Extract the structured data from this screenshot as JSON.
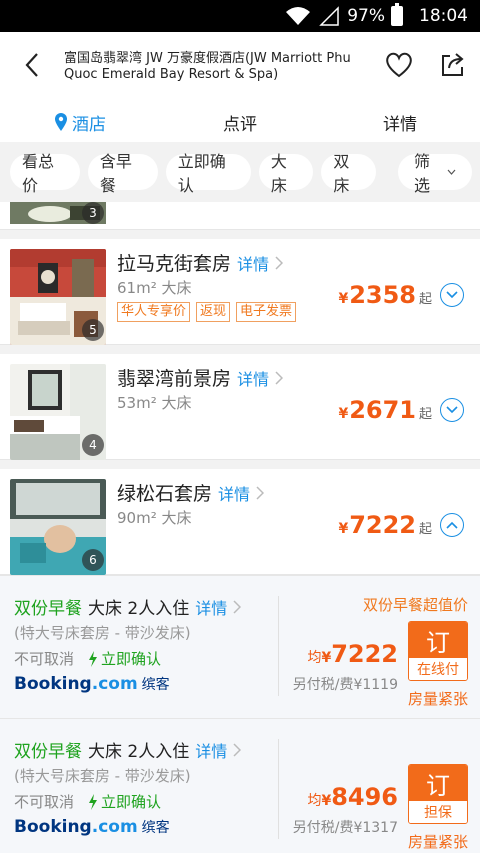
{
  "status_bar": {
    "battery": "97%",
    "time": "18:04"
  },
  "header": {
    "title": "富国岛翡翠湾 JW 万豪度假酒店(JW Marriott Phu Quoc Emerald Bay Resort & Spa)"
  },
  "tabs": [
    {
      "label": "酒店"
    },
    {
      "label": "点评"
    },
    {
      "label": "详情"
    }
  ],
  "filters": {
    "chips": [
      "看总价",
      "含早餐",
      "立即确认",
      "大床",
      "双床"
    ],
    "filter_label": "筛选"
  },
  "partial_room": {
    "photo_count": "3"
  },
  "rooms": [
    {
      "name": "拉马克街套房",
      "detail": "详情",
      "meta": "61m² 大床",
      "tags": [
        "华人专享价",
        "返现",
        "电子发票"
      ],
      "currency": "¥",
      "price": "2358",
      "suffix": "起",
      "photo_count": "5",
      "expanded": false
    },
    {
      "name": "翡翠湾前景房",
      "detail": "详情",
      "meta": "53m² 大床",
      "tags": [],
      "currency": "¥",
      "price": "2671",
      "suffix": "起",
      "photo_count": "4",
      "expanded": false
    },
    {
      "name": "绿松石套房",
      "detail": "详情",
      "meta": "90m² 大床",
      "tags": [],
      "currency": "¥",
      "price": "7222",
      "suffix": "起",
      "photo_count": "6",
      "expanded": true
    }
  ],
  "rate_plans": [
    {
      "meal": "双份早餐",
      "bed": "大床 2人入住",
      "detail": "详情",
      "room_type": "(特大号床套房 - 带沙发床)",
      "cancel": "不可取消",
      "confirm": "立即确认",
      "provider": "Booking",
      "provider_suffix": ".com",
      "provider_cn": "缤客",
      "promo": "双份早餐超值价",
      "price_prefix": "均",
      "currency": "¥",
      "price": "7222",
      "tax": "另付税/费¥1119",
      "book_top": "订",
      "book_bottom": "在线付",
      "scarcity": "房量紧张"
    },
    {
      "meal": "双份早餐",
      "bed": "大床 2人入住",
      "detail": "详情",
      "room_type": "(特大号床套房 - 带沙发床)",
      "cancel": "不可取消",
      "confirm": "立即确认",
      "provider": "Booking",
      "provider_suffix": ".com",
      "provider_cn": "缤客",
      "promo": "",
      "price_prefix": "均",
      "currency": "¥",
      "price": "8496",
      "tax": "另付税/费¥1317",
      "book_top": "订",
      "book_bottom": "担保",
      "scarcity": "房量紧张"
    }
  ],
  "colors": {
    "accent_blue": "#1a8fe3",
    "price_orange": "#f05a14",
    "green": "#1fa31f",
    "booking_navy": "#003580"
  }
}
